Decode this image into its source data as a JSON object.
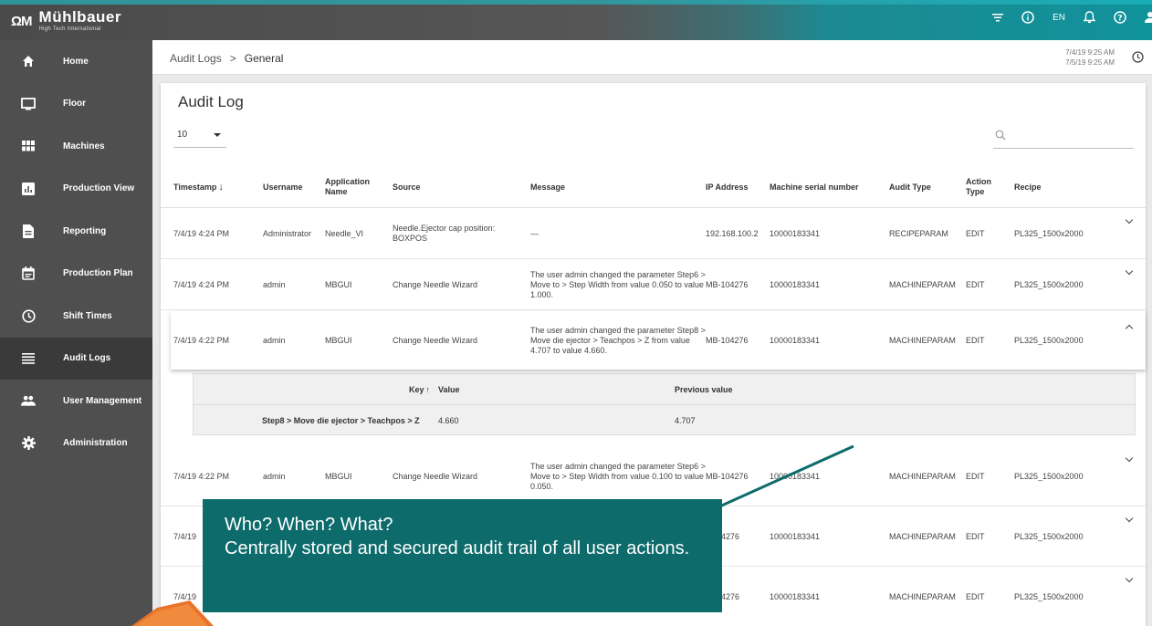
{
  "brand": {
    "mark": "ΩM",
    "name": "Mühlbauer",
    "tagline": "High Tech International"
  },
  "topbar": {
    "icons": [
      "filter-icon",
      "info-icon",
      "bell-icon",
      "help-icon",
      "user-icon"
    ],
    "language": "EN"
  },
  "sidebar": {
    "items": [
      {
        "label": "Home",
        "icon": "home-icon"
      },
      {
        "label": "Floor",
        "icon": "monitor-icon"
      },
      {
        "label": "Machines",
        "icon": "grid-icon"
      },
      {
        "label": "Production View",
        "icon": "bar-chart-icon"
      },
      {
        "label": "Reporting",
        "icon": "document-icon"
      },
      {
        "label": "Production Plan",
        "icon": "calendar-icon"
      },
      {
        "label": "Shift Times",
        "icon": "clock-icon"
      },
      {
        "label": "Audit Logs",
        "icon": "list-icon",
        "active": true
      },
      {
        "label": "User Management",
        "icon": "users-icon"
      },
      {
        "label": "Administration",
        "icon": "settings-icon"
      }
    ]
  },
  "breadcrumb": {
    "parent": "Audit Logs",
    "separator": ">",
    "current": "General"
  },
  "daterange": {
    "from": "7/4/19 9:25 AM",
    "to": "7/5/19 9:25 AM"
  },
  "card": {
    "title": "Audit Log",
    "page_size": "10"
  },
  "table": {
    "headers": {
      "timestamp": "Timestamp",
      "timestamp_sort": "↓",
      "username": "Username",
      "application": "Application Name",
      "source": "Source",
      "message": "Message",
      "ip": "IP Address",
      "serial": "Machine serial number",
      "audit_type": "Audit Type",
      "action_type": "Action Type",
      "recipe": "Recipe"
    },
    "rows": [
      {
        "timestamp": "7/4/19 4:24 PM",
        "username": "Administrator",
        "application": "Needle_VI",
        "source": "Needle.Ejector cap position: BOXPOS",
        "message": "—",
        "ip": "192.168.100.2",
        "serial": "10000183341",
        "audit_type": "RECIPEPARAM",
        "action_type": "EDIT",
        "recipe": "PL325_1500x2000"
      },
      {
        "timestamp": "7/4/19 4:24 PM",
        "username": "admin",
        "application": "MBGUI",
        "source": "Change Needle Wizard",
        "message": "The user admin changed the parameter Step6 > Move to > Step Width from value 0.050 to value 1.000.",
        "ip": "MB-104276",
        "serial": "10000183341",
        "audit_type": "MACHINEPARAM",
        "action_type": "EDIT",
        "recipe": "PL325_1500x2000"
      },
      {
        "timestamp": "7/4/19 4:22 PM",
        "username": "admin",
        "application": "MBGUI",
        "source": "Change Needle Wizard",
        "message": "The user admin changed the parameter Step8 > Move die ejector > Teachpos > Z from value 4.707 to value 4.660.",
        "ip": "MB-104276",
        "serial": "10000183341",
        "audit_type": "MACHINEPARAM",
        "action_type": "EDIT",
        "recipe": "PL325_1500x2000",
        "expanded": true
      },
      {
        "timestamp": "7/4/19 4:22 PM",
        "username": "admin",
        "application": "MBGUI",
        "source": "Change Needle Wizard",
        "message": "The user admin changed the parameter Step6 > Move to > Step Width from value 0.100 to value 0.050.",
        "ip": "MB-104276",
        "serial": "10000183341",
        "audit_type": "MACHINEPARAM",
        "action_type": "EDIT",
        "recipe": "PL325_1500x2000"
      },
      {
        "timestamp": "7/4/19",
        "username": "",
        "application": "",
        "source": "",
        "message": "",
        "ip": "104276",
        "serial": "10000183341",
        "audit_type": "MACHINEPARAM",
        "action_type": "EDIT",
        "recipe": "PL325_1500x2000"
      },
      {
        "timestamp": "7/4/19",
        "username": "",
        "application": "",
        "source": "",
        "message": "",
        "ip": "104276",
        "serial": "10000183341",
        "audit_type": "MACHINEPARAM",
        "action_type": "EDIT",
        "recipe": "PL325_1500x2000"
      }
    ],
    "detail": {
      "headers": {
        "key": "Key",
        "key_sort": "↑",
        "value": "Value",
        "previous": "Previous value"
      },
      "row": {
        "key": "Step8 > Move die ejector > Teachpos > Z",
        "value": "4.660",
        "previous": "4.707"
      }
    }
  },
  "callout": {
    "line1": "Who? When? What?",
    "line2": "Centrally stored and secured audit trail of all user actions."
  },
  "colors": {
    "accent": "#0d6b6b",
    "topbar_teal": "#10929b",
    "sidebar": "#4f4f4f",
    "highlight_orange": "#e8742a"
  }
}
